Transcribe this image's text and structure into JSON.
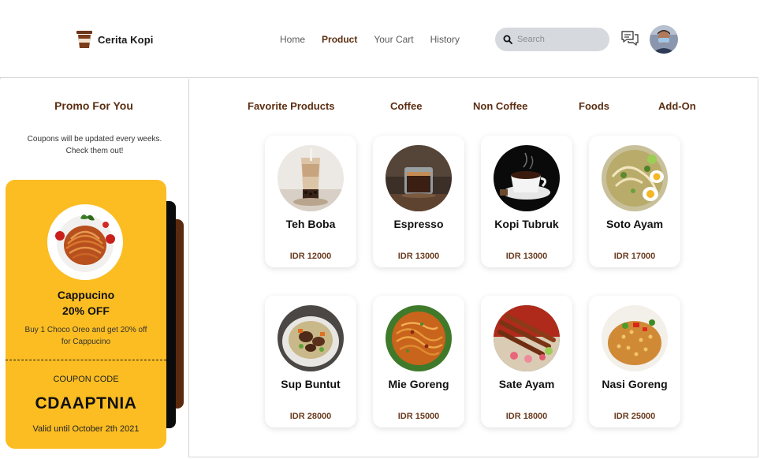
{
  "brand": {
    "name": "Cerita Kopi"
  },
  "nav": {
    "items": [
      {
        "label": "Home",
        "active": false
      },
      {
        "label": "Product",
        "active": true
      },
      {
        "label": "Your Cart",
        "active": false
      },
      {
        "label": "History",
        "active": false
      }
    ]
  },
  "search": {
    "placeholder": "Search",
    "value": ""
  },
  "icons": {
    "search": "search-icon",
    "chat": "chat-icon",
    "avatar": "user-avatar",
    "logo": "coffee-cup-icon"
  },
  "colors": {
    "brown": "#5b2e12",
    "coupon": "#fbbd22",
    "price": "#6b3b1e"
  },
  "sidebar": {
    "title": "Promo For You",
    "subtitle": "Coupons will be updated every weeks. Check them out!",
    "coupon": {
      "name": "Cappucino",
      "discount": "20% OFF",
      "description": "Buy 1 Choco Oreo and get 20% off for Cappucino",
      "code_label": "COUPON CODE",
      "code": "CDAAPTNIA",
      "valid": "Valid until October 2th 2021"
    }
  },
  "categories": [
    "Favorite Products",
    "Coffee",
    "Non Coffee",
    "Foods",
    "Add-On"
  ],
  "products": [
    {
      "name": "Teh Boba",
      "price": "IDR 12000",
      "image": "boba-tea"
    },
    {
      "name": "Espresso",
      "price": "IDR 13000",
      "image": "espresso"
    },
    {
      "name": "Kopi Tubruk",
      "price": "IDR 13000",
      "image": "coffee-cup"
    },
    {
      "name": "Soto Ayam",
      "price": "IDR 17000",
      "image": "soto-ayam"
    },
    {
      "name": "Sup Buntut",
      "price": "IDR 28000",
      "image": "oxtail-soup"
    },
    {
      "name": "Mie Goreng",
      "price": "IDR 15000",
      "image": "fried-noodles"
    },
    {
      "name": "Sate Ayam",
      "price": "IDR 18000",
      "image": "chicken-satay"
    },
    {
      "name": "Nasi Goreng",
      "price": "IDR 25000",
      "image": "fried-rice"
    }
  ]
}
